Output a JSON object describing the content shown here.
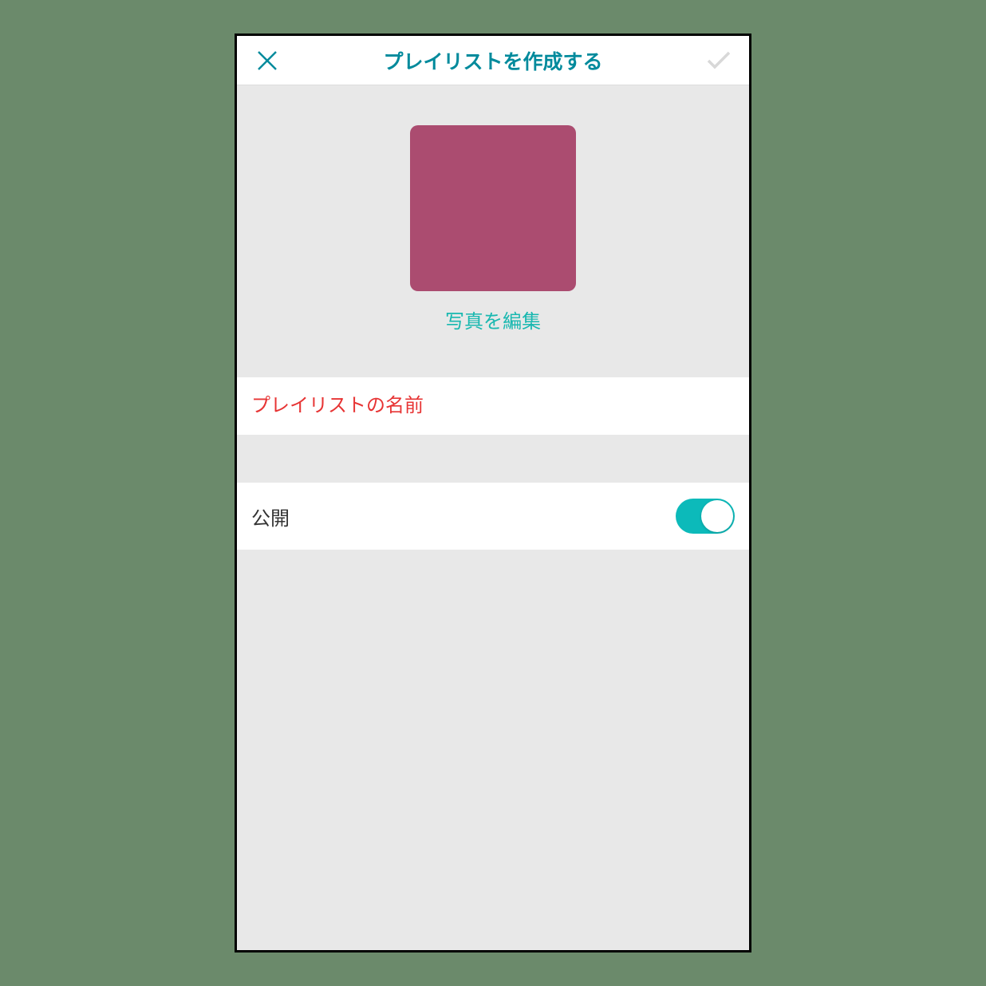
{
  "header": {
    "title": "プレイリストを作成する"
  },
  "photo": {
    "edit_label": "写真を編集"
  },
  "name": {
    "placeholder": "プレイリストの名前"
  },
  "public": {
    "label": "公開",
    "enabled": true
  },
  "colors": {
    "accent_teal": "#008a9c",
    "bright_teal": "#19b8b0",
    "toggle_teal": "#0cbaba",
    "photo_bg": "#ab4c70",
    "error_red": "#e73434",
    "check_disabled": "#d8d8d8"
  }
}
